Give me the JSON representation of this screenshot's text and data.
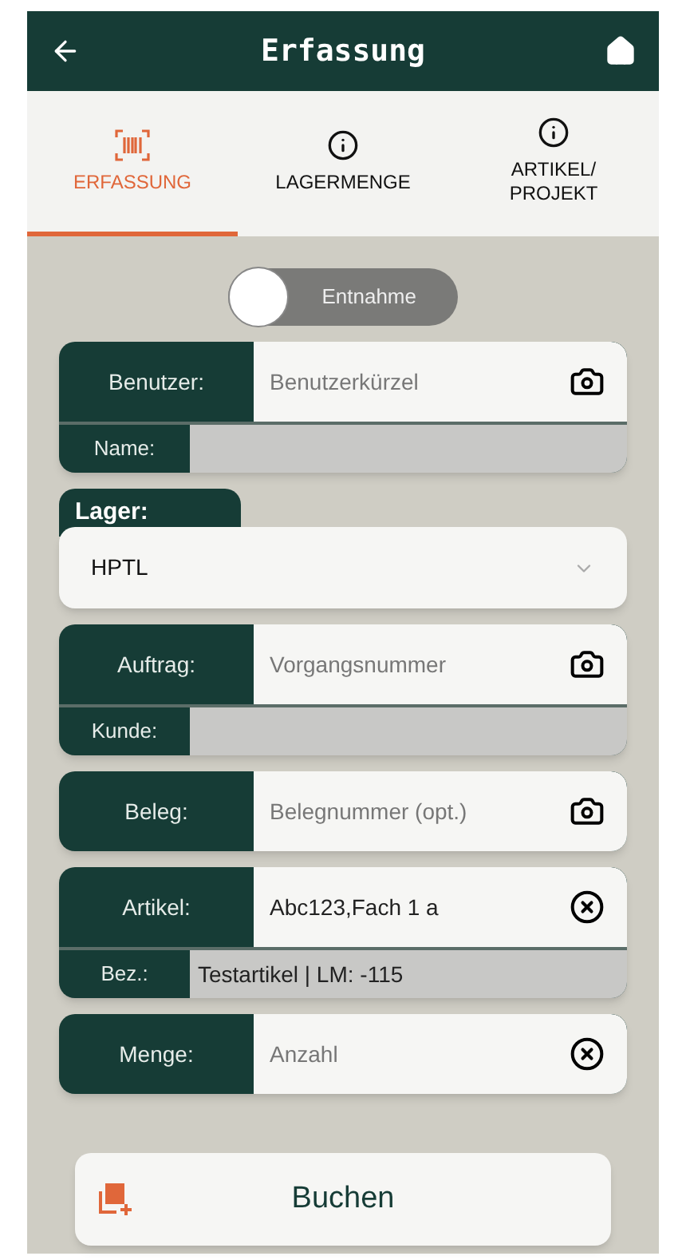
{
  "header": {
    "title": "Erfassung"
  },
  "tabs": [
    {
      "lines": [
        "ERFASSUNG"
      ],
      "kind": "scan",
      "selected": true
    },
    {
      "lines": [
        "LAGERMENGE"
      ],
      "kind": "info",
      "selected": false
    },
    {
      "lines": [
        "ARTIKEL/",
        "PROJEKT"
      ],
      "kind": "info",
      "selected": false
    }
  ],
  "toggle": {
    "label": "Entnahme",
    "on": false
  },
  "fields_top": [
    {
      "label": "Benutzer:",
      "placeholder": "Benutzerkürzel",
      "kind": "scan",
      "sub": {
        "label": "Name:"
      }
    }
  ],
  "lager": {
    "label": "Lager:",
    "value": "HPTL"
  },
  "fields": [
    {
      "label": "Auftrag:",
      "placeholder": "Vorgangsnummer",
      "kind": "scan",
      "sub": {
        "label": "Kunde:"
      }
    },
    {
      "label": "Beleg:",
      "placeholder": "Belegnummer (opt.)",
      "kind": "scan"
    },
    {
      "label": "Artikel:",
      "value": "Abc123,Fach 1 a",
      "kind": "clearable",
      "sub": {
        "label": "Bez.:",
        "value": "Testartikel | LM: -115"
      }
    },
    {
      "label": "Menge:",
      "placeholder": "Anzahl",
      "kind": "clearable"
    }
  ],
  "submit": {
    "label": "Buchen"
  }
}
